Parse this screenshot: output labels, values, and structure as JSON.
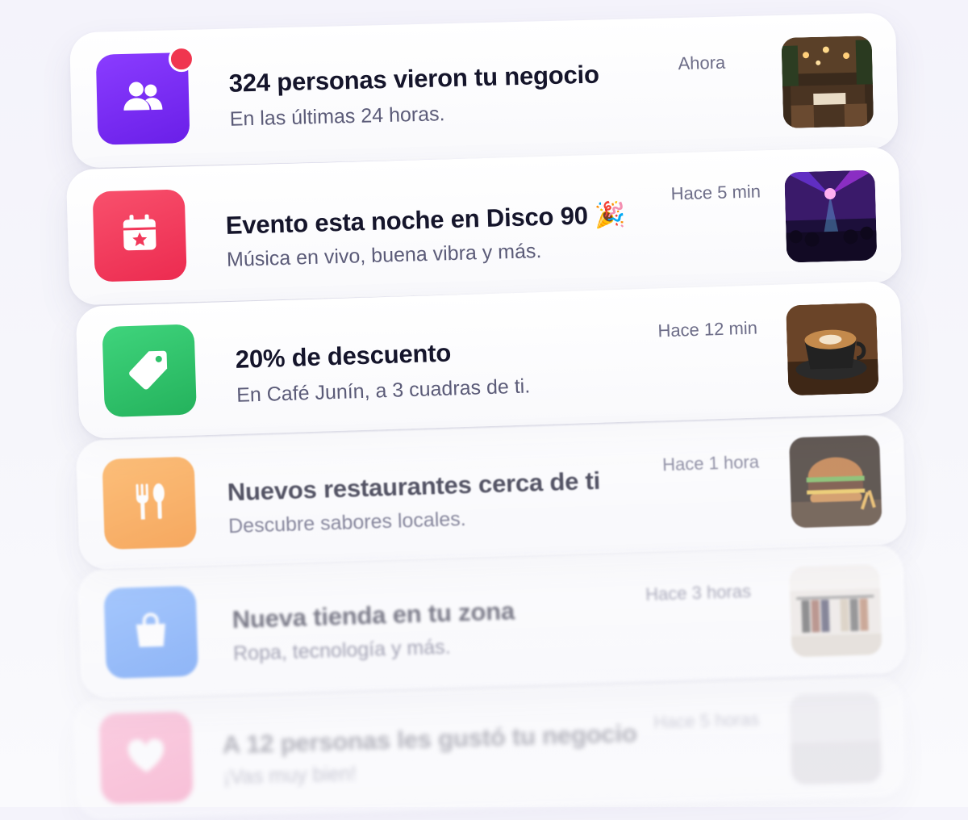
{
  "notifications": [
    {
      "title": "324 personas vieron tu negocio",
      "subtitle": "En las últimas 24 horas.",
      "time": "Ahora",
      "icon": "people-icon",
      "icon_color": "#7a2cf2",
      "unread": true,
      "thumbnail": "restaurant-interior"
    },
    {
      "title": "Evento esta noche en Disco 90 🎉",
      "subtitle": "Música en vivo, buena vibra y más.",
      "time": "Hace 5 min",
      "icon": "calendar-star-icon",
      "icon_color": "#f2385a",
      "unread": false,
      "thumbnail": "disco-crowd"
    },
    {
      "title": "20% de descuento",
      "subtitle": "En Café Junín, a 3 cuadras de ti.",
      "time": "Hace 12 min",
      "icon": "tag-icon",
      "icon_color": "#2fc26a",
      "unread": false,
      "thumbnail": "latte-coffee"
    },
    {
      "title": "Nuevos restaurantes cerca de ti",
      "subtitle": "Descubre sabores locales.",
      "time": "Hace 1 hora",
      "icon": "fork-spoon-icon",
      "icon_color": "#f99a32",
      "unread": false,
      "thumbnail": "burger"
    },
    {
      "title": "Nueva tienda en tu zona",
      "subtitle": "Ropa, tecnología y más.",
      "time": "Hace 3 horas",
      "icon": "shopping-bag-icon",
      "icon_color": "#4a8df6",
      "unread": false,
      "thumbnail": "clothing-store"
    },
    {
      "title": "A 12 personas les gustó tu negocio",
      "subtitle": "¡Vas muy bien!",
      "time": "Hace 5 horas",
      "icon": "heart-icon",
      "icon_color": "#f44b8c",
      "unread": false,
      "thumbnail": "blurred"
    }
  ]
}
